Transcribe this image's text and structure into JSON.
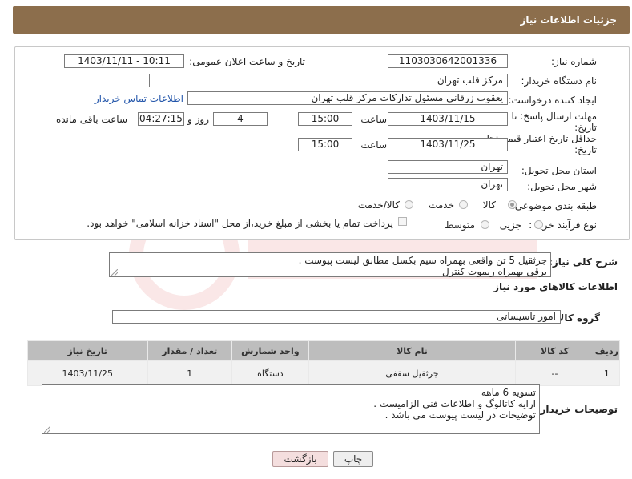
{
  "header": {
    "title": "جزئیات اطلاعات نیاز"
  },
  "form": {
    "need_number_label": "شماره نیاز:",
    "need_number": "1103030642001336",
    "announce_label": "تاریخ و ساعت اعلان عمومی:",
    "announce_value": "1403/11/11 - 10:11",
    "buyer_org_label": "نام دستگاه خریدار:",
    "buyer_org": "مرکز قلب تهران",
    "creator_label": "ایجاد کننده درخواست:",
    "creator": "یعقوب زرقانی مسئول تدارکات مرکز قلب تهران",
    "contact_link": "اطلاعات تماس خریدار",
    "deadline_label_1": "مهلت ارسال پاسخ: تا",
    "deadline_label_2": "تاریخ:",
    "deadline_date": "1403/11/15",
    "time_label": "ساعت",
    "deadline_time": "15:00",
    "days_value": "4",
    "days_label": "روز و",
    "remaining_time": "04:27:15",
    "remaining_label": "ساعت باقی مانده",
    "validity_label_1": "حداقل تاریخ اعتبار قیمت: تا",
    "validity_label_2": "تاریخ:",
    "validity_date": "1403/11/25",
    "validity_time": "15:00",
    "province_label": "استان محل تحویل:",
    "province": "تهران",
    "city_label": "شهر محل تحویل:",
    "city": "تهران",
    "category_label": "طبقه بندی موضوعی:",
    "category_options": [
      "کالا",
      "خدمت",
      "کالا/خدمت"
    ],
    "process_label": "نوع فرآیند خرید :",
    "process_options": [
      "جزیی",
      "متوسط"
    ],
    "payment_note": "پرداخت تمام یا بخشی از مبلغ خرید،از محل \"اسناد خزانه اسلامی\" خواهد بود."
  },
  "description": {
    "label": "شرح کلی نیاز:",
    "lines": [
      "جرثقیل 5 تن واقعی بهمراه  سیم بکسل مطابق لیست پیوست .",
      "برقی بهمراه ریموت کنترل"
    ]
  },
  "goods_section_title": "اطلاعات کالاهای مورد نیاز",
  "goods_group_label": "گروه کالا:",
  "goods_group": "امور تاسیساتی",
  "table": {
    "headers": [
      "ردیف",
      "کد کالا",
      "نام کالا",
      "واحد شمارش",
      "تعداد / مقدار",
      "تاریخ نیاز"
    ],
    "rows": [
      [
        "1",
        "--",
        "جرثقیل سقفی",
        "دستگاه",
        "1",
        "1403/11/25"
      ]
    ]
  },
  "buyer_notes": {
    "label": "توضیحات خریدار:",
    "lines": [
      "تسویه 6 ماهه",
      "ارایه کاتالوگ و اطلاعات فنی الزامیست .",
      "توضیحات در لیست پیوست می باشد ."
    ]
  },
  "buttons": {
    "print": "چاپ",
    "back": "بازگشت"
  }
}
